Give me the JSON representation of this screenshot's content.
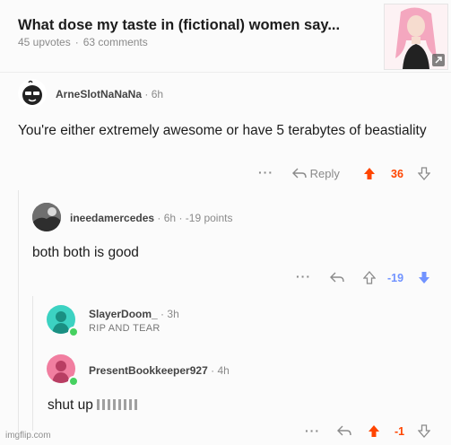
{
  "post": {
    "title": "What dose my taste in (fictional) women say...",
    "upvotes": "45 upvotes",
    "comments": "63 comments",
    "separator": "·"
  },
  "comments": [
    {
      "username": "ArneSlotNaNaNa",
      "age": "6h",
      "body": "You're either extremely awesome or have 5 terabytes of beastiality",
      "reply_label": "Reply",
      "score": "36",
      "vote": "upvoted"
    },
    {
      "username": "ineedamercedes",
      "age": "6h",
      "points": "-19 points",
      "body": "both both is good",
      "score": "-19",
      "vote": "downvoted"
    },
    {
      "username": "SlayerDoom_",
      "age": "3h",
      "flair": "RIP AND TEAR"
    },
    {
      "username": "PresentBookkeeper927",
      "age": "4h",
      "body": "shut up",
      "score": "-1",
      "vote": "upvoted"
    }
  ],
  "colors": {
    "upvote": "#ff4500",
    "downvote": "#7193ff",
    "muted": "#8a8a8a",
    "online": "#46d160"
  },
  "icons": [
    "more-icon",
    "reply-icon",
    "upvote-icon",
    "downvote-icon",
    "expand-icon"
  ],
  "watermark": "imgflip.com"
}
